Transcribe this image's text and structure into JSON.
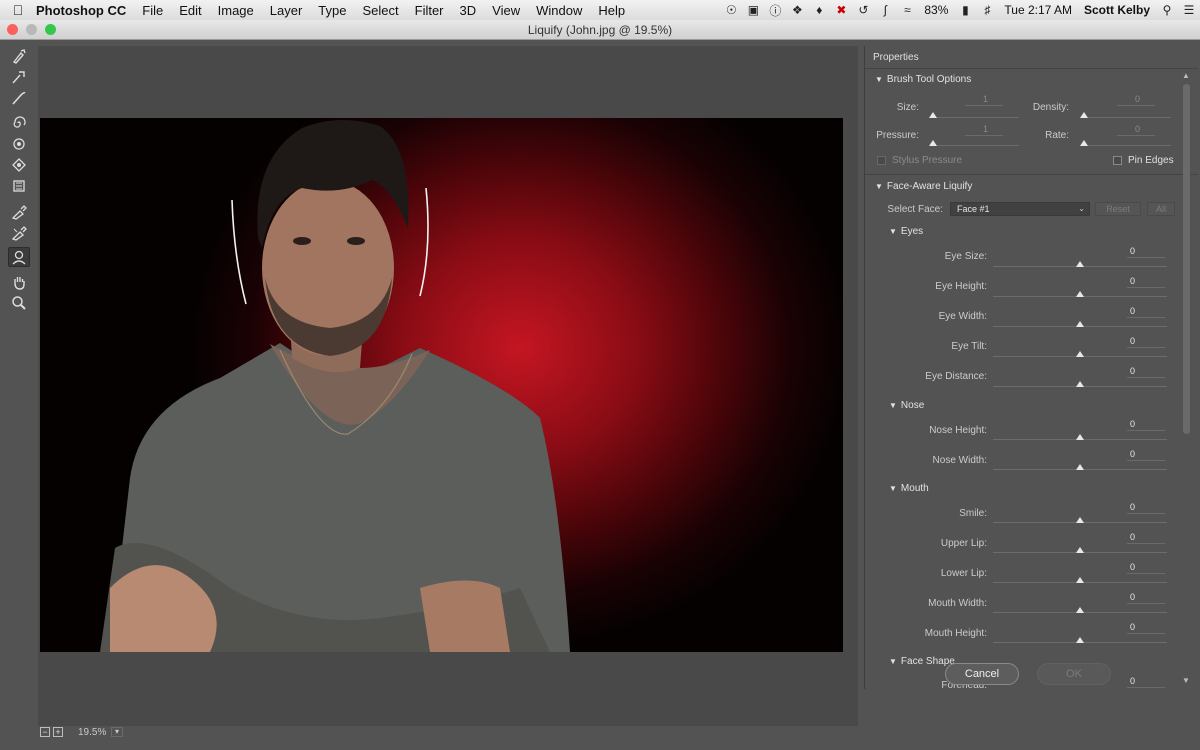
{
  "menubar": {
    "app_name": "Photoshop CC",
    "items": [
      "File",
      "Edit",
      "Image",
      "Layer",
      "Type",
      "Select",
      "Filter",
      "3D",
      "View",
      "Window",
      "Help"
    ],
    "battery": "83%",
    "clock": "Tue 2:17 AM",
    "user": "Scott Kelby"
  },
  "window": {
    "title": "Liquify (John.jpg @ 19.5%)"
  },
  "canvas": {
    "zoom": "19.5%"
  },
  "panel": {
    "title": "Properties",
    "brush": {
      "header": "Brush Tool Options",
      "size_label": "Size:",
      "size_value": "1",
      "density_label": "Density:",
      "density_value": "0",
      "pressure_label": "Pressure:",
      "pressure_value": "1",
      "rate_label": "Rate:",
      "rate_value": "0",
      "stylus_label": "Stylus Pressure",
      "pin_edges_label": "Pin Edges"
    },
    "face": {
      "header": "Face-Aware Liquify",
      "select_face_label": "Select Face:",
      "select_face_value": "Face #1",
      "reset_label": "Reset",
      "all_label": "All",
      "groups": [
        {
          "name": "Eyes",
          "sliders": [
            {
              "label": "Eye Size:",
              "value": "0"
            },
            {
              "label": "Eye Height:",
              "value": "0"
            },
            {
              "label": "Eye Width:",
              "value": "0"
            },
            {
              "label": "Eye Tilt:",
              "value": "0"
            },
            {
              "label": "Eye Distance:",
              "value": "0"
            }
          ]
        },
        {
          "name": "Nose",
          "sliders": [
            {
              "label": "Nose Height:",
              "value": "0"
            },
            {
              "label": "Nose Width:",
              "value": "0"
            }
          ]
        },
        {
          "name": "Mouth",
          "sliders": [
            {
              "label": "Smile:",
              "value": "0"
            },
            {
              "label": "Upper Lip:",
              "value": "0"
            },
            {
              "label": "Lower Lip:",
              "value": "0"
            },
            {
              "label": "Mouth Width:",
              "value": "0"
            },
            {
              "label": "Mouth Height:",
              "value": "0"
            }
          ]
        },
        {
          "name": "Face Shape",
          "sliders": [
            {
              "label": "Forehead:",
              "value": "0"
            }
          ]
        }
      ]
    }
  },
  "buttons": {
    "cancel": "Cancel",
    "ok": "OK"
  },
  "colors": {
    "photo_background": "#c41622",
    "panel": "#535353",
    "canvas": "#494949"
  },
  "tools": [
    "forward-warp-icon",
    "reconstruct-icon",
    "smooth-icon",
    "twirl-clockwise-icon",
    "pucker-icon",
    "bloat-icon",
    "push-left-icon",
    "freeze-mask-icon",
    "thaw-mask-icon",
    "face-tool-icon",
    "hand-icon",
    "zoom-icon"
  ]
}
